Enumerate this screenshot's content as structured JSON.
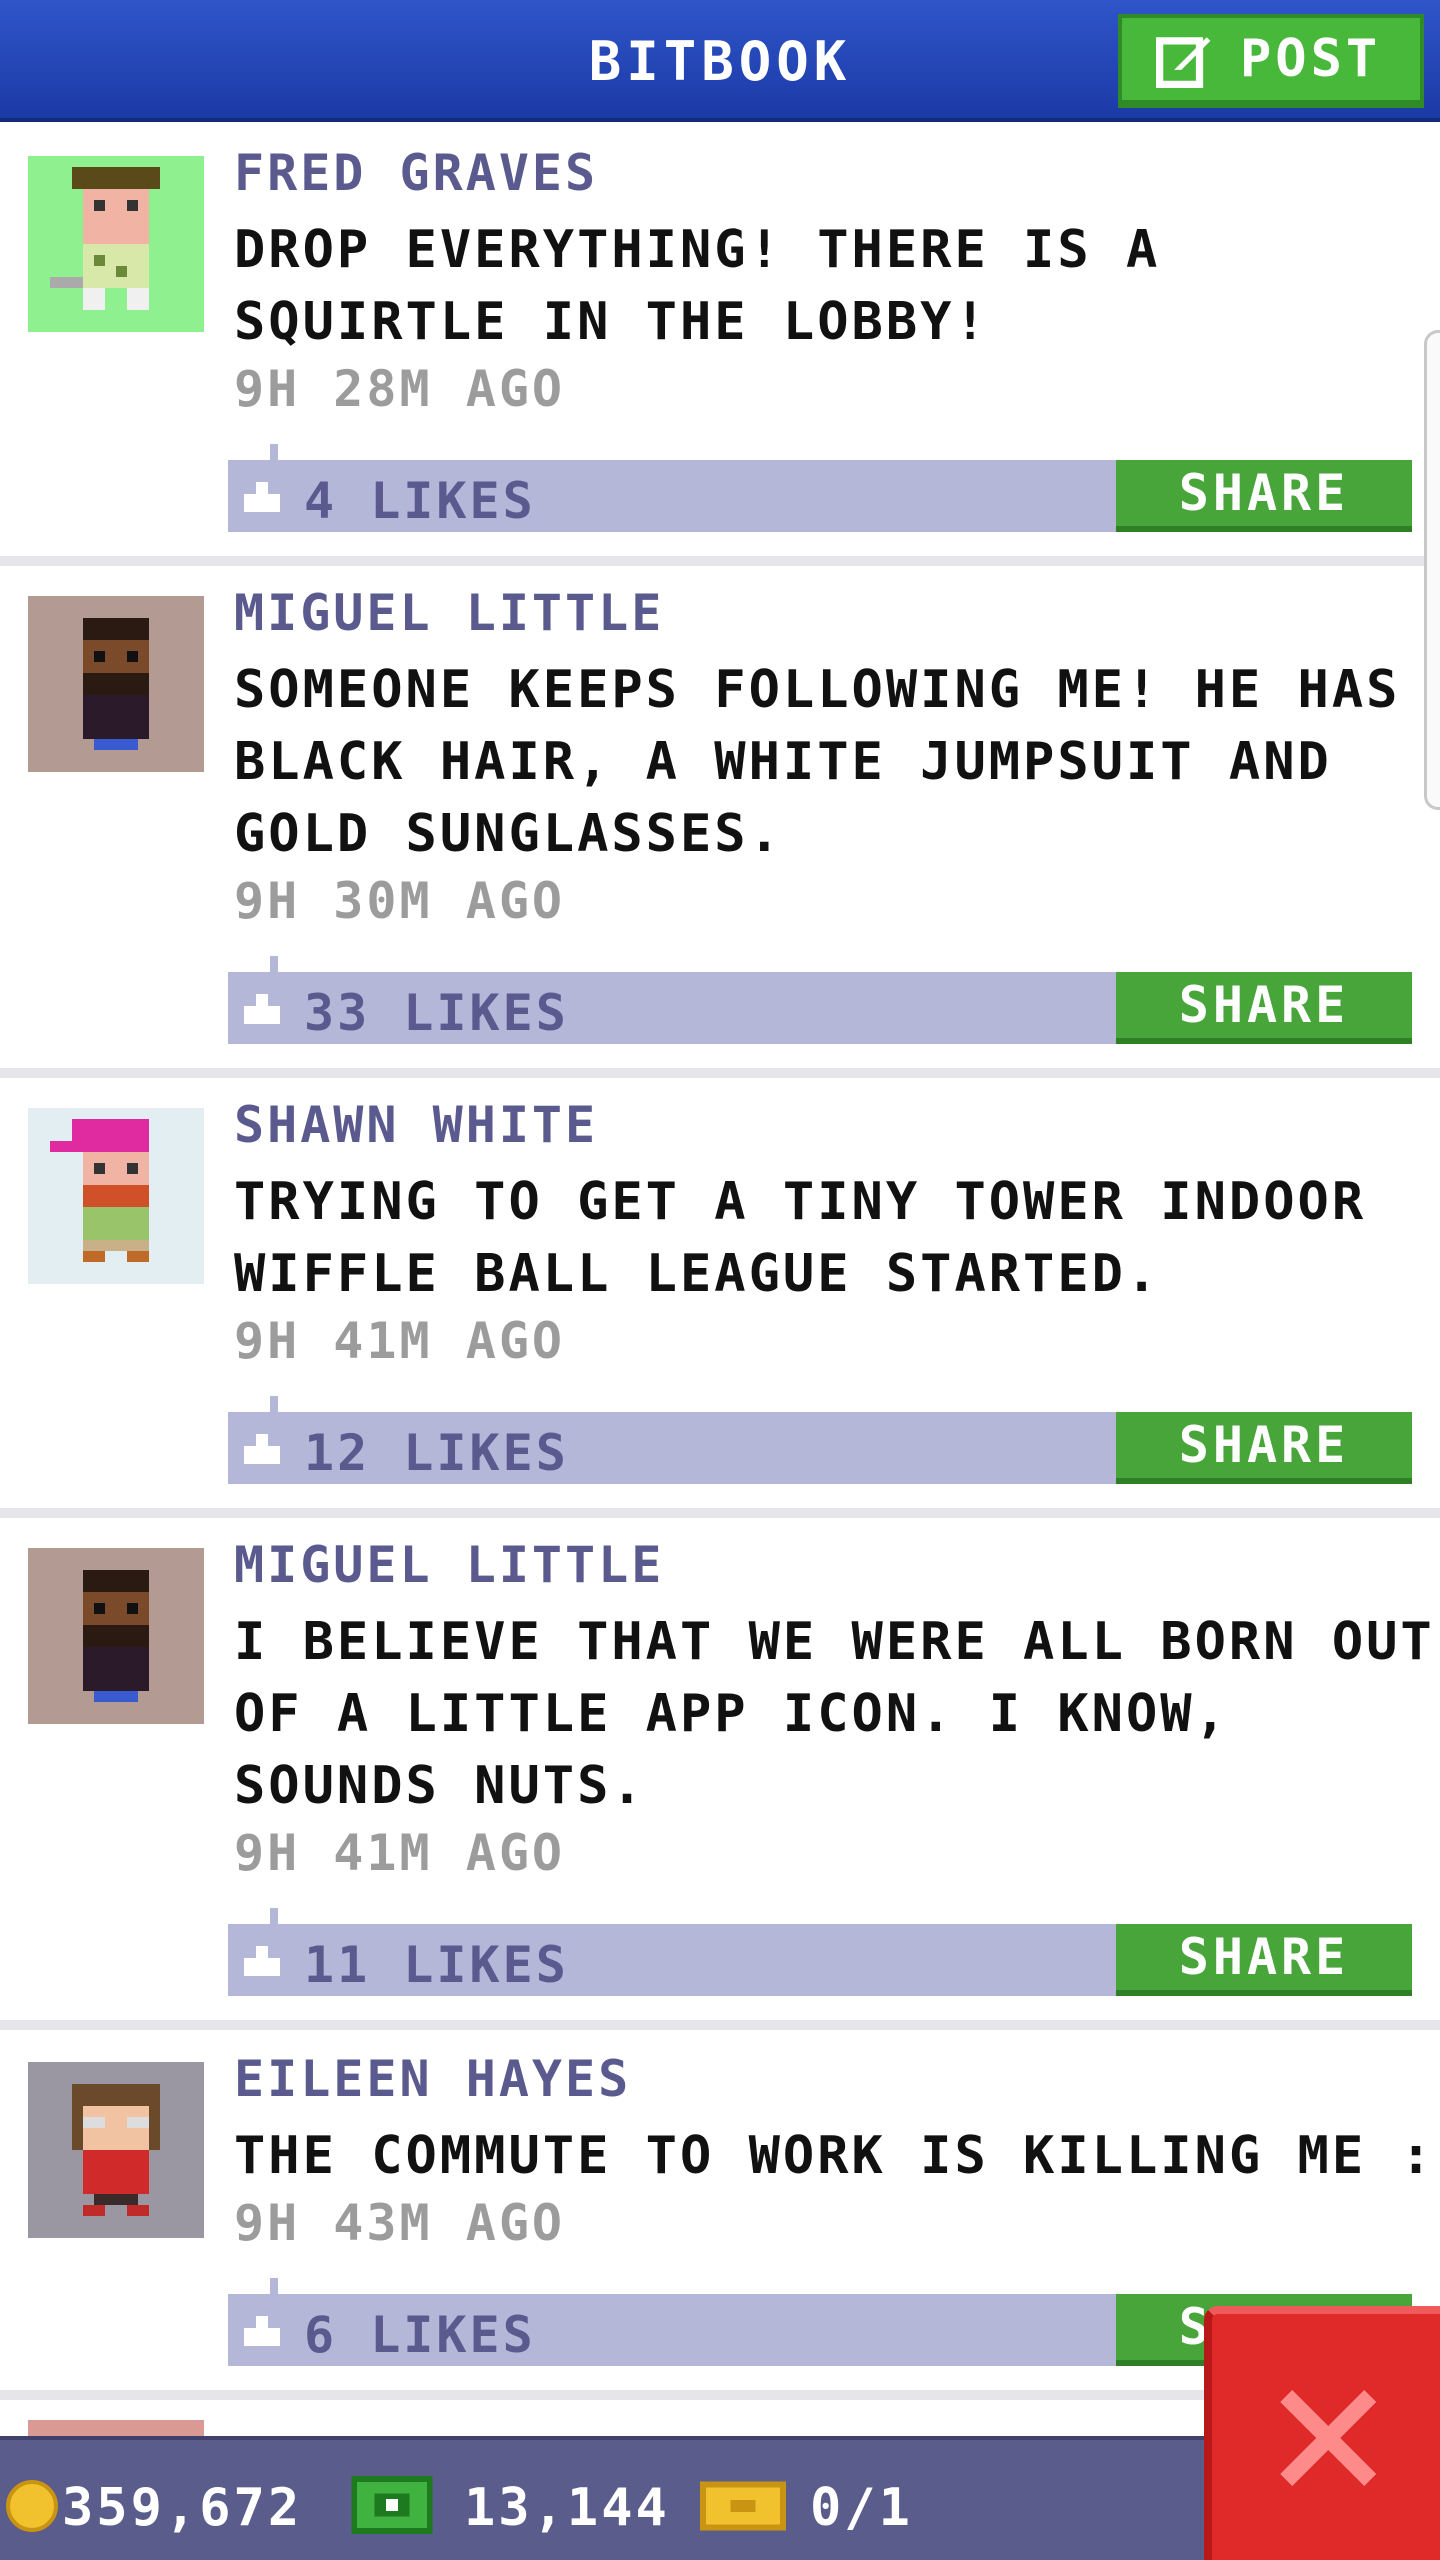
{
  "header": {
    "title": "BITBOOK",
    "post_label": "POST"
  },
  "posts": [
    {
      "author": "FRED GRAVES",
      "text": "DROP EVERYTHING! THERE IS A SQUIRTLE IN THE LOBBY!",
      "time": "9H 28M AGO",
      "likes": "4 LIKES",
      "share_label": "SHARE",
      "avatar_icon": "golfer-avatar-icon"
    },
    {
      "author": "MIGUEL LITTLE",
      "text": "SOMEONE KEEPS FOLLOWING ME! HE HAS BLACK HAIR, A WHITE JUMPSUIT AND GOLD SUNGLASSES.",
      "time": "9H 30M AGO",
      "likes": "33 LIKES",
      "share_label": "SHARE",
      "avatar_icon": "bearded-man-avatar-icon"
    },
    {
      "author": "SHAWN WHITE",
      "text": "TRYING TO GET A TINY TOWER INDOOR WIFFLE BALL LEAGUE STARTED.",
      "time": "9H 41M AGO",
      "likes": "12 LIKES",
      "share_label": "SHARE",
      "avatar_icon": "cap-man-avatar-icon"
    },
    {
      "author": "MIGUEL LITTLE",
      "text": "I BELIEVE THAT WE WERE ALL BORN OUT OF A LITTLE APP ICON. I KNOW, SOUNDS NUTS.",
      "time": "9H 41M AGO",
      "likes": "11 LIKES",
      "share_label": "SHARE",
      "avatar_icon": "bearded-man-avatar-icon"
    },
    {
      "author": "EILEEN HAYES",
      "text": "THE COMMUTE TO WORK IS KILLING ME :(",
      "time": "9H 43M AGO",
      "likes": "6 LIKES",
      "share_label": "SHARE",
      "avatar_icon": "glasses-woman-avatar-icon"
    }
  ],
  "status": {
    "coins": "359,672",
    "bux": "13,144",
    "tickets": "0/1"
  },
  "colors": {
    "header_blue": "#2f55c9",
    "share_green": "#47a53a",
    "likes_bar": "#b5b7d9",
    "author_purple": "#5b5a8e",
    "close_red": "#e02a2a"
  }
}
